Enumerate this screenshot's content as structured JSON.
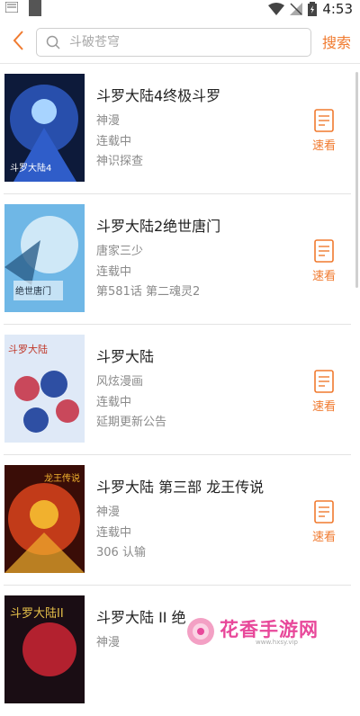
{
  "statusbar": {
    "time": "4:53"
  },
  "search": {
    "placeholder": "斗破苍穹",
    "button": "搜索"
  },
  "items": [
    {
      "title": "斗罗大陆4终极斗罗",
      "author": "神漫",
      "status": "连载中",
      "latest": "神识探查",
      "read_label": "速看",
      "cover_colors": [
        "#0d1a3a",
        "#2f5dc9",
        "#a8d4ff"
      ]
    },
    {
      "title": "斗罗大陆2绝世唐门",
      "author": "唐家三少",
      "status": "连载中",
      "latest": "第581话 第二魂灵2",
      "read_label": "速看",
      "cover_colors": [
        "#6fb7e6",
        "#cfe8f7",
        "#2b5e8a"
      ]
    },
    {
      "title": "斗罗大陆",
      "author": "风炫漫画",
      "status": "连载中",
      "latest": "延期更新公告",
      "read_label": "速看",
      "cover_colors": [
        "#dfe9f7",
        "#c9485b",
        "#2e4fa3"
      ]
    },
    {
      "title": "斗罗大陆 第三部 龙王传说",
      "author": "神漫",
      "status": "连载中",
      "latest": "306 认输",
      "read_label": "速看",
      "cover_colors": [
        "#3a0d07",
        "#d2401c",
        "#f1b12e"
      ]
    },
    {
      "title": "斗罗大陆 II 绝",
      "author": "神漫",
      "status": "",
      "latest": "",
      "read_label": "",
      "cover_colors": [
        "#1a0d14",
        "#b3212f",
        "#e6c04a"
      ]
    }
  ],
  "watermark": {
    "text": "花香手游网",
    "url": "www.hxsy.vip"
  },
  "colors": {
    "accent": "#f07a2f"
  }
}
